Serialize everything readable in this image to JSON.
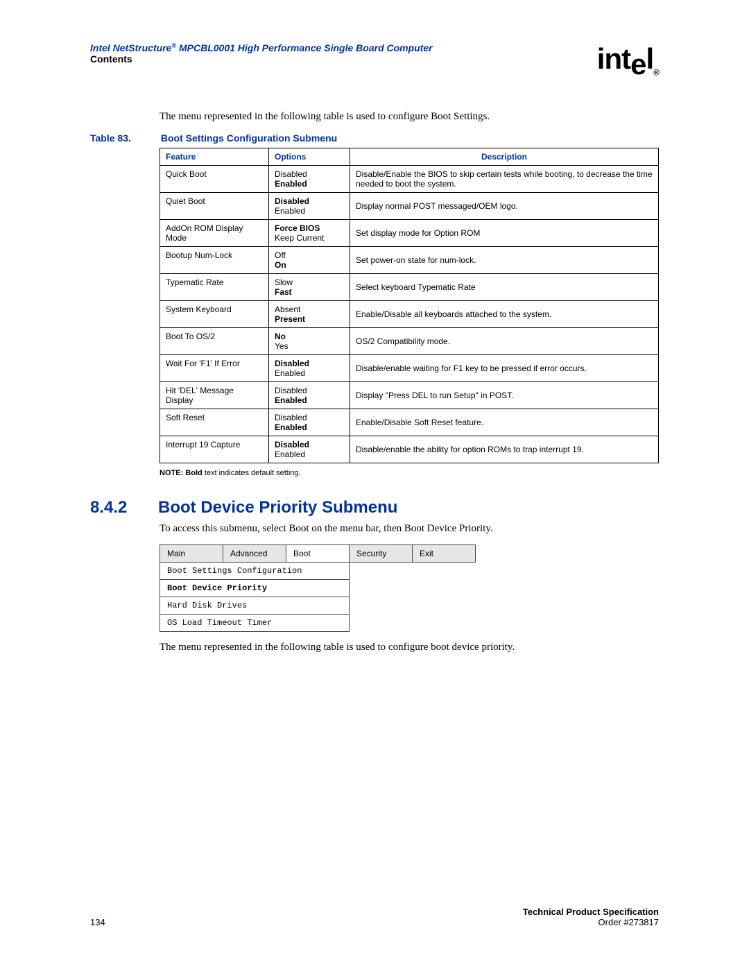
{
  "header": {
    "title_pre": "Intel NetStructure",
    "title_sup": "®",
    "title_post": " MPCBL0001 High Performance Single Board Computer",
    "contents": "Contents",
    "logo_text": "intel",
    "logo_reg": "®"
  },
  "intro": "The menu represented in the following table is used to configure Boot Settings.",
  "table_caption": {
    "num": "Table 83.",
    "title": "Boot Settings Configuration Submenu"
  },
  "table_headers": {
    "feature": "Feature",
    "options": "Options",
    "description": "Description"
  },
  "table_rows": [
    {
      "feature": "Quick Boot",
      "opt1": "Disabled",
      "opt1_bold": false,
      "opt2": "Enabled",
      "opt2_bold": true,
      "desc": "Disable/Enable the BIOS to skip certain tests while booting, to decrease the time needed to boot the system."
    },
    {
      "feature": "Quiet Boot",
      "opt1": "Disabled",
      "opt1_bold": true,
      "opt2": "Enabled",
      "opt2_bold": false,
      "desc": "Display normal POST messaged/OEM logo."
    },
    {
      "feature": "AddOn ROM Display Mode",
      "opt1": "Force BIOS",
      "opt1_bold": true,
      "opt2": "Keep Current",
      "opt2_bold": false,
      "desc": "Set display mode for Option ROM"
    },
    {
      "feature": "Bootup Num-Lock",
      "opt1": "Off",
      "opt1_bold": false,
      "opt2": "On",
      "opt2_bold": true,
      "desc": "Set power-on state for num-lock."
    },
    {
      "feature": "Typematic Rate",
      "opt1": "Slow",
      "opt1_bold": false,
      "opt2": "Fast",
      "opt2_bold": true,
      "desc": "Select keyboard Typematic Rate"
    },
    {
      "feature": "System Keyboard",
      "opt1": "Absent",
      "opt1_bold": false,
      "opt2": "Present",
      "opt2_bold": true,
      "desc": "Enable/Disable all keyboards attached to the system."
    },
    {
      "feature": "Boot To OS/2",
      "opt1": "No",
      "opt1_bold": true,
      "opt2": "Yes",
      "opt2_bold": false,
      "desc": "OS/2 Compatibility mode."
    },
    {
      "feature": "Wait For 'F1' If Error",
      "opt1": "Disabled",
      "opt1_bold": true,
      "opt2": "Enabled",
      "opt2_bold": false,
      "desc": "Disable/enable waiting for F1 key to be pressed if error occurs."
    },
    {
      "feature": "Hit 'DEL' Message Display",
      "opt1": "Disabled",
      "opt1_bold": false,
      "opt2": "Enabled",
      "opt2_bold": true,
      "desc": "Display \"Press DEL to run Setup\" in POST."
    },
    {
      "feature": "Soft Reset",
      "opt1": "Disabled",
      "opt1_bold": false,
      "opt2": "Enabled",
      "opt2_bold": true,
      "desc": "Enable/Disable Soft Reset feature."
    },
    {
      "feature": "Interrupt 19 Capture",
      "opt1": "Disabled",
      "opt1_bold": true,
      "opt2": "Enabled",
      "opt2_bold": false,
      "desc": "Disable/enable the ability for option ROMs to trap interrupt 19."
    }
  ],
  "note": {
    "prefix": "NOTE:",
    "body": " Bold",
    "rest": " text indicates default setting."
  },
  "section": {
    "num": "8.4.2",
    "title": "Boot Device Priority Submenu"
  },
  "section_intro": "To access this submenu, select Boot on the menu bar, then Boot Device Priority.",
  "menu_tabs": [
    "Main",
    "Advanced",
    "Boot",
    "Security",
    "Exit"
  ],
  "menu_items": [
    {
      "label": "Boot Settings Configuration",
      "selected": false
    },
    {
      "label": "Boot Device Priority",
      "selected": true
    },
    {
      "label": "Hard Disk Drives",
      "selected": false
    },
    {
      "label": "OS Load Timeout Timer",
      "selected": false
    }
  ],
  "closing": "The menu represented in the following table is used to configure boot device priority.",
  "footer": {
    "page": "134",
    "spec": "Technical Product Specification",
    "order": "Order #273817"
  }
}
